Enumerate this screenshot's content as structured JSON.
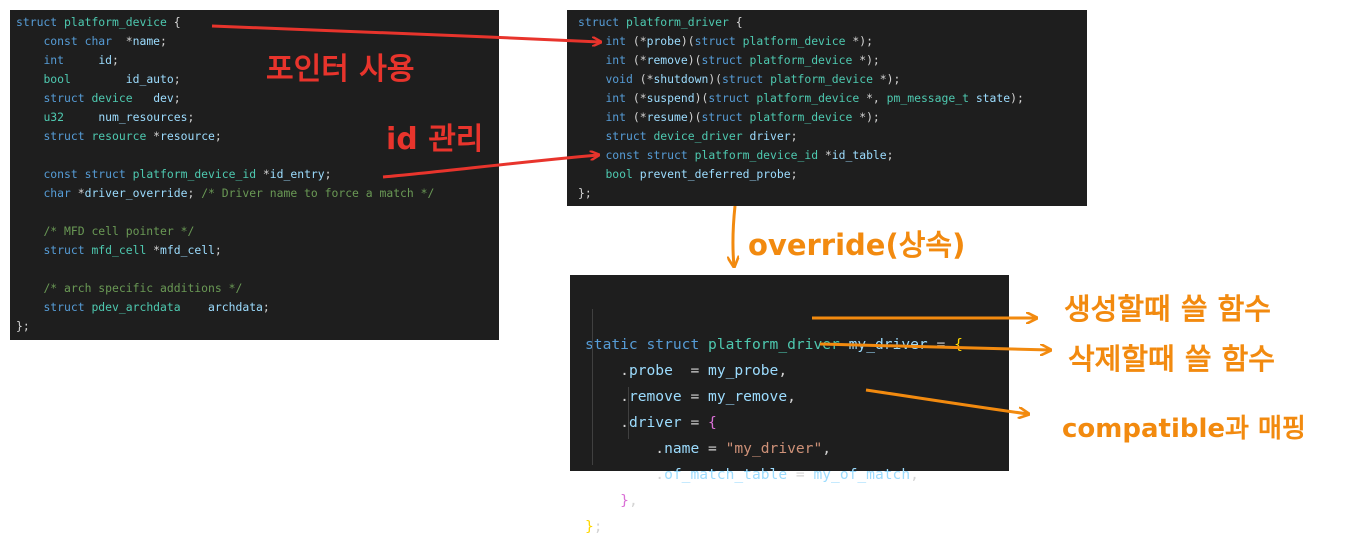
{
  "platform_device_box": {
    "lines": [
      {
        "indent": 0,
        "tokens": [
          [
            "kw",
            "struct"
          ],
          [
            "pl",
            " "
          ],
          [
            "ty",
            "platform_device"
          ],
          [
            "pl",
            " {"
          ]
        ]
      },
      {
        "indent": 1,
        "tokens": [
          [
            "kw",
            "const"
          ],
          [
            "pl",
            " "
          ],
          [
            "kw",
            "char"
          ],
          [
            "pl",
            "  *"
          ],
          [
            "mb",
            "name"
          ],
          [
            "pl",
            ";"
          ]
        ]
      },
      {
        "indent": 1,
        "tokens": [
          [
            "kw",
            "int"
          ],
          [
            "pl",
            "     "
          ],
          [
            "mb",
            "id"
          ],
          [
            "pl",
            ";"
          ]
        ]
      },
      {
        "indent": 1,
        "tokens": [
          [
            "ty",
            "bool"
          ],
          [
            "pl",
            "        "
          ],
          [
            "mb",
            "id_auto"
          ],
          [
            "pl",
            ";"
          ]
        ]
      },
      {
        "indent": 1,
        "tokens": [
          [
            "kw",
            "struct"
          ],
          [
            "pl",
            " "
          ],
          [
            "ty",
            "device"
          ],
          [
            "pl",
            "   "
          ],
          [
            "mb",
            "dev"
          ],
          [
            "pl",
            ";"
          ]
        ]
      },
      {
        "indent": 1,
        "tokens": [
          [
            "ty",
            "u32"
          ],
          [
            "pl",
            "     "
          ],
          [
            "mb",
            "num_resources"
          ],
          [
            "pl",
            ";"
          ]
        ]
      },
      {
        "indent": 1,
        "tokens": [
          [
            "kw",
            "struct"
          ],
          [
            "pl",
            " "
          ],
          [
            "ty",
            "resource"
          ],
          [
            "pl",
            " *"
          ],
          [
            "mb",
            "resource"
          ],
          [
            "pl",
            ";"
          ]
        ]
      },
      {
        "indent": 0,
        "tokens": []
      },
      {
        "indent": 1,
        "tokens": [
          [
            "kw",
            "const"
          ],
          [
            "pl",
            " "
          ],
          [
            "kw",
            "struct"
          ],
          [
            "pl",
            " "
          ],
          [
            "ty",
            "platform_device_id"
          ],
          [
            "pl",
            " *"
          ],
          [
            "mb",
            "id_entry"
          ],
          [
            "pl",
            ";"
          ]
        ]
      },
      {
        "indent": 1,
        "tokens": [
          [
            "kw",
            "char"
          ],
          [
            "pl",
            " *"
          ],
          [
            "mb",
            "driver_override"
          ],
          [
            "pl",
            "; "
          ],
          [
            "cm",
            "/* Driver name to force a match */"
          ]
        ]
      },
      {
        "indent": 0,
        "tokens": []
      },
      {
        "indent": 1,
        "tokens": [
          [
            "cm",
            "/* MFD cell pointer */"
          ]
        ]
      },
      {
        "indent": 1,
        "tokens": [
          [
            "kw",
            "struct"
          ],
          [
            "pl",
            " "
          ],
          [
            "ty",
            "mfd_cell"
          ],
          [
            "pl",
            " *"
          ],
          [
            "mb",
            "mfd_cell"
          ],
          [
            "pl",
            ";"
          ]
        ]
      },
      {
        "indent": 0,
        "tokens": []
      },
      {
        "indent": 1,
        "tokens": [
          [
            "cm",
            "/* arch specific additions */"
          ]
        ]
      },
      {
        "indent": 1,
        "tokens": [
          [
            "kw",
            "struct"
          ],
          [
            "pl",
            " "
          ],
          [
            "ty",
            "pdev_archdata"
          ],
          [
            "pl",
            "    "
          ],
          [
            "mb",
            "archdata"
          ],
          [
            "pl",
            ";"
          ]
        ]
      },
      {
        "indent": 0,
        "tokens": [
          [
            "pl",
            "};"
          ]
        ]
      }
    ]
  },
  "platform_driver_box": {
    "lines": [
      {
        "indent": 0,
        "tokens": [
          [
            "kw",
            "struct"
          ],
          [
            "pl",
            " "
          ],
          [
            "ty",
            "platform_driver"
          ],
          [
            "pl",
            " {"
          ]
        ]
      },
      {
        "indent": 1,
        "tokens": [
          [
            "kw",
            "int"
          ],
          [
            "pl",
            " (*"
          ],
          [
            "mb",
            "probe"
          ],
          [
            "pl",
            ")("
          ],
          [
            "kw",
            "struct"
          ],
          [
            "pl",
            " "
          ],
          [
            "ty",
            "platform_device"
          ],
          [
            "pl",
            " *);"
          ]
        ]
      },
      {
        "indent": 1,
        "tokens": [
          [
            "kw",
            "int"
          ],
          [
            "pl",
            " (*"
          ],
          [
            "mb",
            "remove"
          ],
          [
            "pl",
            ")("
          ],
          [
            "kw",
            "struct"
          ],
          [
            "pl",
            " "
          ],
          [
            "ty",
            "platform_device"
          ],
          [
            "pl",
            " *);"
          ]
        ]
      },
      {
        "indent": 1,
        "tokens": [
          [
            "kw",
            "void"
          ],
          [
            "pl",
            " (*"
          ],
          [
            "mb",
            "shutdown"
          ],
          [
            "pl",
            ")("
          ],
          [
            "kw",
            "struct"
          ],
          [
            "pl",
            " "
          ],
          [
            "ty",
            "platform_device"
          ],
          [
            "pl",
            " *);"
          ]
        ]
      },
      {
        "indent": 1,
        "tokens": [
          [
            "kw",
            "int"
          ],
          [
            "pl",
            " (*"
          ],
          [
            "mb",
            "suspend"
          ],
          [
            "pl",
            ")("
          ],
          [
            "kw",
            "struct"
          ],
          [
            "pl",
            " "
          ],
          [
            "ty",
            "platform_device"
          ],
          [
            "pl",
            " *, "
          ],
          [
            "ty",
            "pm_message_t"
          ],
          [
            "pl",
            " "
          ],
          [
            "mb",
            "state"
          ],
          [
            "pl",
            ");"
          ]
        ]
      },
      {
        "indent": 1,
        "tokens": [
          [
            "kw",
            "int"
          ],
          [
            "pl",
            " (*"
          ],
          [
            "mb",
            "resume"
          ],
          [
            "pl",
            ")("
          ],
          [
            "kw",
            "struct"
          ],
          [
            "pl",
            " "
          ],
          [
            "ty",
            "platform_device"
          ],
          [
            "pl",
            " *);"
          ]
        ]
      },
      {
        "indent": 1,
        "tokens": [
          [
            "kw",
            "struct"
          ],
          [
            "pl",
            " "
          ],
          [
            "ty",
            "device_driver"
          ],
          [
            "pl",
            " "
          ],
          [
            "mb",
            "driver"
          ],
          [
            "pl",
            ";"
          ]
        ]
      },
      {
        "indent": 1,
        "tokens": [
          [
            "kw",
            "const"
          ],
          [
            "pl",
            " "
          ],
          [
            "kw",
            "struct"
          ],
          [
            "pl",
            " "
          ],
          [
            "ty",
            "platform_device_id"
          ],
          [
            "pl",
            " *"
          ],
          [
            "mb",
            "id_table"
          ],
          [
            "pl",
            ";"
          ]
        ]
      },
      {
        "indent": 1,
        "tokens": [
          [
            "ty",
            "bool"
          ],
          [
            "pl",
            " "
          ],
          [
            "mb",
            "prevent_deferred_probe"
          ],
          [
            "pl",
            ";"
          ]
        ]
      },
      {
        "indent": 0,
        "tokens": [
          [
            "pl",
            "};"
          ]
        ]
      }
    ]
  },
  "my_driver_box": {
    "lines": [
      {
        "indent": 0,
        "tokens": [
          [
            "kw",
            "static"
          ],
          [
            "pl",
            " "
          ],
          [
            "kw",
            "struct"
          ],
          [
            "pl",
            " "
          ],
          [
            "ty",
            "platform_driver"
          ],
          [
            "pl",
            " "
          ],
          [
            "mb",
            "my_driver"
          ],
          [
            "pl",
            " = "
          ],
          [
            "br-y",
            "{"
          ]
        ]
      },
      {
        "indent": 1,
        "tokens": [
          [
            "pl",
            "."
          ],
          [
            "mb",
            "probe"
          ],
          [
            "pl",
            "  = "
          ],
          [
            "mb",
            "my_probe"
          ],
          [
            "pl",
            ","
          ]
        ]
      },
      {
        "indent": 1,
        "tokens": [
          [
            "pl",
            "."
          ],
          [
            "mb",
            "remove"
          ],
          [
            "pl",
            " = "
          ],
          [
            "mb",
            "my_remove"
          ],
          [
            "pl",
            ","
          ]
        ]
      },
      {
        "indent": 1,
        "tokens": [
          [
            "pl",
            "."
          ],
          [
            "mb",
            "driver"
          ],
          [
            "pl",
            " = "
          ],
          [
            "br-p",
            "{"
          ]
        ]
      },
      {
        "indent": 2,
        "tokens": [
          [
            "pl",
            "."
          ],
          [
            "mb",
            "name"
          ],
          [
            "pl",
            " = "
          ],
          [
            "st",
            "\"my_driver\""
          ],
          [
            "pl",
            ","
          ]
        ]
      },
      {
        "indent": 2,
        "tokens": [
          [
            "pl",
            "."
          ],
          [
            "mb",
            "of_match_table"
          ],
          [
            "pl",
            " = "
          ],
          [
            "mb",
            "my_of_match"
          ],
          [
            "pl",
            ","
          ]
        ]
      },
      {
        "indent": 1,
        "tokens": [
          [
            "br-p",
            "}"
          ],
          [
            "pl",
            ","
          ]
        ]
      },
      {
        "indent": 0,
        "tokens": [
          [
            "br-y",
            "}"
          ],
          [
            "pl",
            ";"
          ]
        ]
      }
    ]
  },
  "annotations": {
    "pointer_use": "포인터 사용",
    "id_management": "id 관리",
    "override": "override(상속)",
    "probe_note": "생성할때 쓸 함수",
    "remove_note": "삭제할때 쓸 함수",
    "compatible_note": "compatible과 매핑"
  },
  "colors": {
    "code_background": "#1e1e1e",
    "keyword": "#569cd6",
    "type": "#4ec9b0",
    "member": "#9cdcfe",
    "comment": "#6a9955",
    "string": "#ce9178",
    "red_annotation": "#e8342c",
    "orange_annotation": "#f28a0f"
  }
}
